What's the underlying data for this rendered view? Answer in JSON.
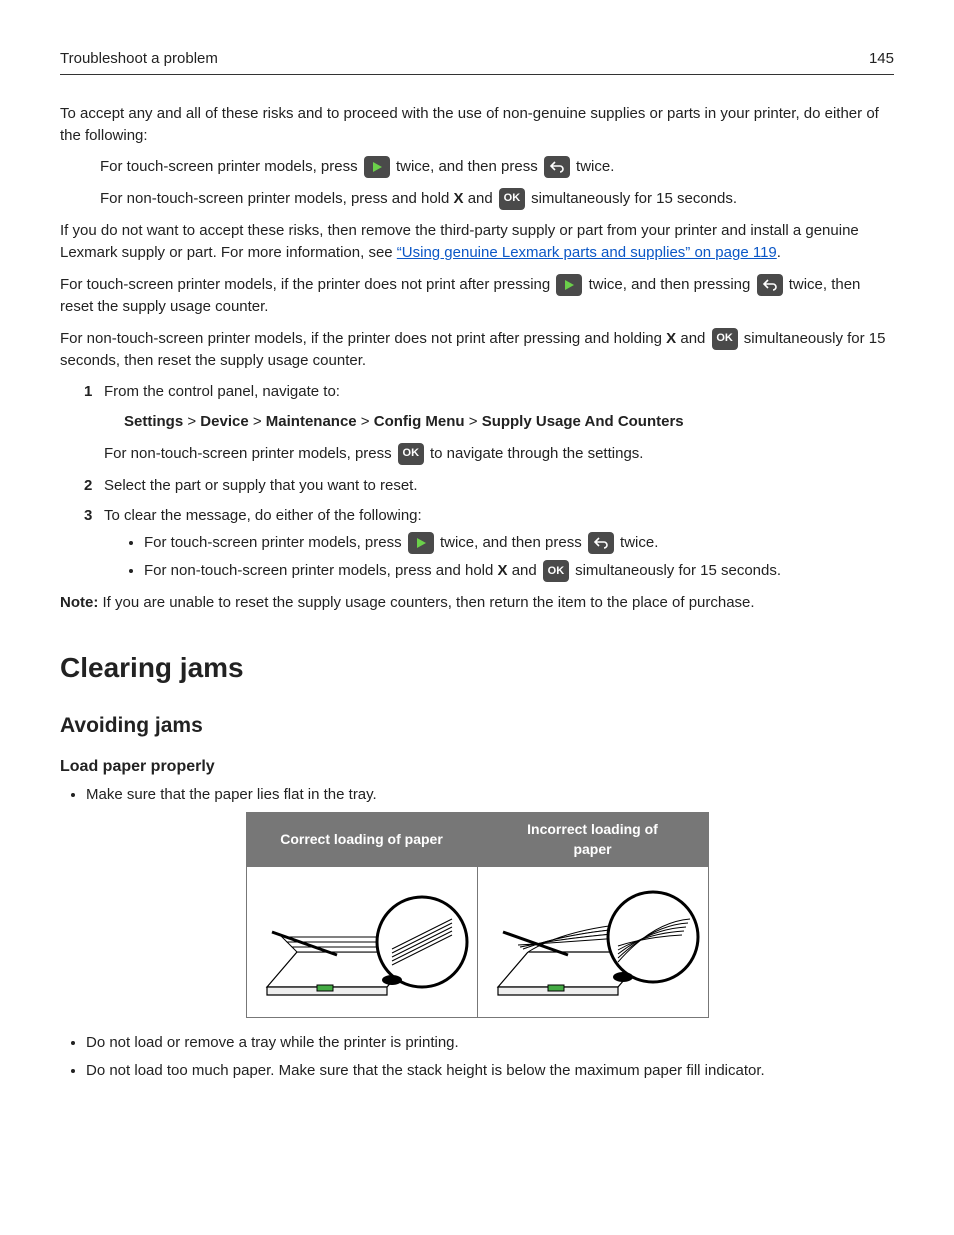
{
  "header": {
    "section": "Troubleshoot a problem",
    "page": "145"
  },
  "p_intro": "To accept any and all of these risks and to proceed with the use of non-genuine supplies or parts in your printer, do either of the following:",
  "touch_pre": "For touch-screen printer models, press ",
  "twice_then_press": " twice, and then press ",
  "twice": " twice.",
  "nontouch_pre": "For non-touch-screen printer models, press and hold ",
  "x_and": " and ",
  "sim15": " simultaneously for 15 seconds.",
  "risk_p1": "If you do not want to accept these risks, then remove the third-party supply or part from your printer and install a genuine Lexmark supply or part. For more information, see ",
  "risk_link": "“Using genuine Lexmark parts and supplies” on page 119",
  "period": ".",
  "touch_reset_a": "For touch-screen printer models, if the printer does not print after pressing ",
  "touch_reset_b": " twice, and then pressing ",
  "touch_reset_c": " twice, then reset the supply usage counter.",
  "nontouch_reset_a": "For non-touch-screen printer models, if the printer does not print after pressing and holding ",
  "nontouch_reset_b": " simultaneously for 15 seconds, then reset the supply usage counter.",
  "X": "X",
  "OK": "OK",
  "step1": "From the control panel, navigate to:",
  "path": {
    "p1": "Settings",
    "p2": "Device",
    "p3": "Maintenance",
    "p4": "Config Menu",
    "p5": "Supply Usage And Counters",
    "sep": " > "
  },
  "step1b_a": "For non-touch-screen printer models, press ",
  "step1b_b": " to navigate through the settings.",
  "step2": "Select the part or supply that you want to reset.",
  "step3": "To clear the message, do either of the following:",
  "step3_touch_pre": "For touch-screen printer models, press ",
  "step3_nontouch_pre": "For non-touch-screen printer models, press and hold ",
  "note_label": "Note:",
  "note_text": " If you are unable to reset the supply usage counters, then return the item to the place of purchase.",
  "h1": "Clearing jams",
  "h2": "Avoiding jams",
  "h3": "Load paper properly",
  "b1": "Make sure that the paper lies flat in the tray.",
  "th1": "Correct loading of paper",
  "th2": "Incorrect loading of paper",
  "b2": "Do not load or remove a tray while the printer is printing.",
  "b3": "Do not load too much paper. Make sure that the stack height is below the maximum paper fill indicator."
}
